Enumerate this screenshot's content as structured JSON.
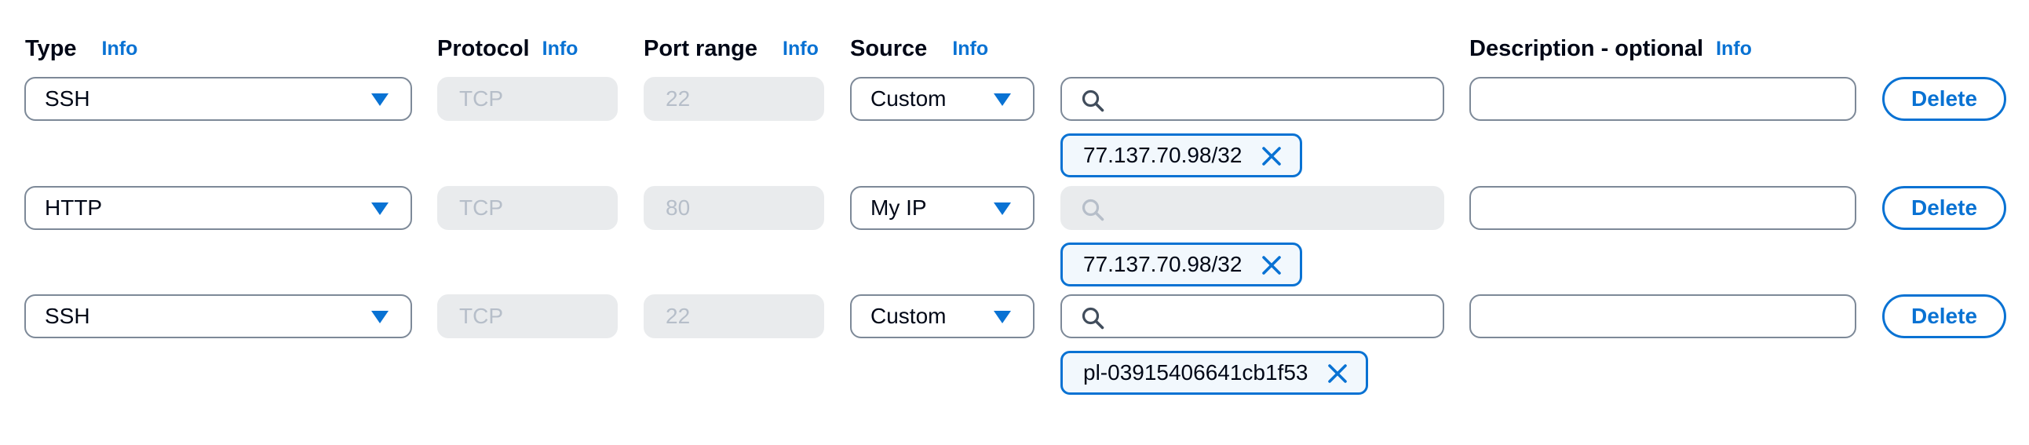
{
  "headers": {
    "type": {
      "label": "Type",
      "info": "Info"
    },
    "protocol": {
      "label": "Protocol",
      "info": "Info"
    },
    "port_range": {
      "label": "Port range",
      "info": "Info"
    },
    "source": {
      "label": "Source",
      "info": "Info"
    },
    "description": {
      "label": "Description - optional",
      "info": "Info"
    }
  },
  "rules": [
    {
      "type": "SSH",
      "protocol": "TCP",
      "port_range": "22",
      "source": "Custom",
      "search_disabled": false,
      "description": "",
      "token": "77.137.70.98/32",
      "delete_label": "Delete"
    },
    {
      "type": "HTTP",
      "protocol": "TCP",
      "port_range": "80",
      "source": "My IP",
      "search_disabled": true,
      "description": "",
      "token": "77.137.70.98/32",
      "delete_label": "Delete"
    },
    {
      "type": "SSH",
      "protocol": "TCP",
      "port_range": "22",
      "source": "Custom",
      "search_disabled": false,
      "description": "",
      "token": "pl-03915406641cb1f53",
      "delete_label": "Delete"
    }
  ],
  "colors": {
    "accent": "#0972d3",
    "disabled_bg": "#e9ebed",
    "border": "#7d8998",
    "token_bg": "#f2f8fd"
  },
  "icons": {
    "select_caret": "caret-down-icon",
    "search": "search-icon",
    "token_remove": "close-icon"
  }
}
